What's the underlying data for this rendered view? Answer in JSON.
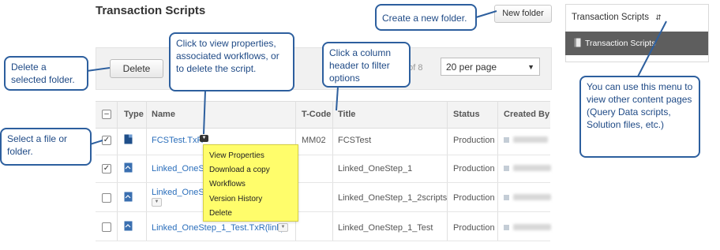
{
  "page": {
    "title": "Transaction Scripts"
  },
  "toolbar": {
    "delete_label": "Delete",
    "new_folder_label": "New folder",
    "pager_text": "8 of 8",
    "per_page_value": "20 per page"
  },
  "table": {
    "columns": [
      "Type",
      "Name",
      "T-Code",
      "Title",
      "Status",
      "Created By"
    ],
    "rows": [
      {
        "checked": true,
        "name": "FCSTest.TxR",
        "tcode": "MM02",
        "title": "FCSTest",
        "status": "Production"
      },
      {
        "checked": true,
        "name": "Linked_OneS",
        "tcode": "",
        "title": "Linked_OneStep_1",
        "status": "Production"
      },
      {
        "checked": false,
        "name": "Linked_OneS",
        "tcode": "",
        "title": "Linked_OneStep_1_2scripts",
        "status": "Production"
      },
      {
        "checked": false,
        "name": "Linked_OneStep_1_Test.TxR(link)",
        "tcode": "",
        "title": "Linked_OneStep_1_Test",
        "status": "Production"
      }
    ]
  },
  "context_menu": {
    "items": [
      "View Properties",
      "Download a copy",
      "Workflows",
      "Version History",
      "Delete"
    ]
  },
  "right_panel": {
    "menu_title": "Transaction Scripts",
    "selected_item": "Transaction Scripts"
  },
  "callouts": {
    "new_folder": "Create a new folder.",
    "delete_folder": "Delete a selected folder.",
    "properties": "Click to view properties, associated workflows, or to delete the script.",
    "column_header": "Click a column header to filter options",
    "select_file": "Select a file or folder.",
    "menu": "You can use this menu to view other content pages (Query Data scripts, Solution files, etc.)"
  },
  "colors": {
    "callout_border": "#2d5f9e",
    "callout_text": "#1f4a86",
    "highlight": "#fffd6b",
    "link": "#2a6ebb",
    "panel_selected": "#5e5e5e"
  },
  "icons": [
    "checkbox-icon",
    "document-icon",
    "linked-document-icon",
    "dropdown-arrow-icon",
    "sort-icon",
    "user-icon"
  ]
}
